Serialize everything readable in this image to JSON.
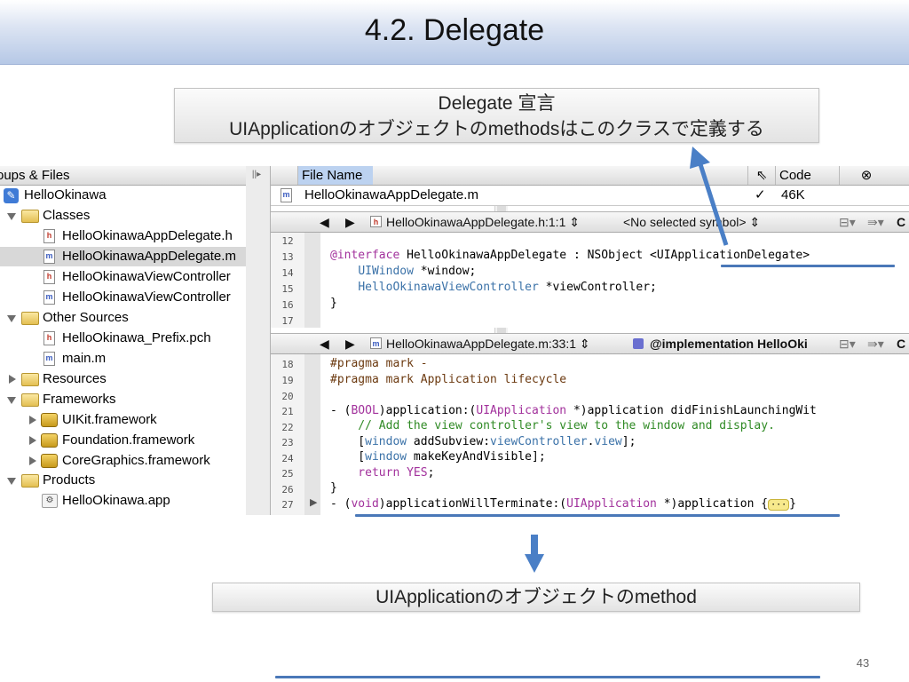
{
  "slide": {
    "title": "4.2. Delegate",
    "callout_top_line1": "Delegate 宣言",
    "callout_top_line2": "UIApplicationのオブジェクトのmethodsはこのクラスで定義する",
    "callout_bottom": "UIApplicationのオブジェクトのmethod",
    "page_number": "43"
  },
  "sidebar": {
    "header": "oups & Files",
    "items": [
      {
        "label": "HelloOkinawa",
        "kind": "project"
      },
      {
        "label": "Classes",
        "kind": "folder-open"
      },
      {
        "label": "HelloOkinawaAppDelegate.h",
        "kind": "h"
      },
      {
        "label": "HelloOkinawaAppDelegate.m",
        "kind": "m"
      },
      {
        "label": "HelloOkinawaViewController",
        "kind": "h"
      },
      {
        "label": "HelloOkinawaViewController",
        "kind": "m"
      },
      {
        "label": "Other Sources",
        "kind": "folder-open"
      },
      {
        "label": "HelloOkinawa_Prefix.pch",
        "kind": "h"
      },
      {
        "label": "main.m",
        "kind": "m"
      },
      {
        "label": "Resources",
        "kind": "folder-closed"
      },
      {
        "label": "Frameworks",
        "kind": "folder-open"
      },
      {
        "label": "UIKit.framework",
        "kind": "framework"
      },
      {
        "label": "Foundation.framework",
        "kind": "framework"
      },
      {
        "label": "CoreGraphics.framework",
        "kind": "framework"
      },
      {
        "label": "Products",
        "kind": "folder-open"
      },
      {
        "label": "HelloOkinawa.app",
        "kind": "app"
      }
    ]
  },
  "file_list": {
    "col_name": "File Name",
    "col_code": "Code",
    "row_name": "HelloOkinawaAppDelegate.m",
    "row_code": "46K"
  },
  "header_pane": {
    "file": "HelloOkinawaAppDelegate.h:1:1",
    "symbol": "<No selected symbol>",
    "lines": [
      "12",
      "13",
      "14",
      "15",
      "16",
      "17"
    ],
    "code": {
      "l13_kw": "@interface",
      "l13_rest": " HelloOkinawaAppDelegate : NSObject <UIApplicationDelegate>",
      "l14_cls": "UIWindow",
      "l14_rest": " *window;",
      "l15_cls": "HelloOkinawaViewController",
      "l15_rest": " *viewController;",
      "l16": "}"
    }
  },
  "impl_pane": {
    "file": "HelloOkinawaAppDelegate.m:33:1",
    "symbol": "@implementation HelloOki",
    "lines": [
      "18",
      "19",
      "20",
      "21",
      "22",
      "23",
      "24",
      "25",
      "26",
      "27"
    ],
    "code": {
      "l18": "#pragma mark -",
      "l19": "#pragma mark Application lifecycle",
      "l21_a": "- (",
      "l21_bool": "BOOL",
      "l21_b": ")application:(",
      "l21_cls": "UIApplication",
      "l21_c": " *)application didFinishLaunchingWit",
      "l22": "    // Add the view controller's view to the window and display.",
      "l23_a": "    [",
      "l23_win": "window",
      "l23_b": " addSubview:",
      "l23_vc": "viewController",
      "l23_c": ".",
      "l23_view": "view",
      "l23_d": "];",
      "l24_a": "    [",
      "l24_win": "window",
      "l24_b": " makeKeyAndVisible];",
      "l25_kw": "    return",
      "l25_yes": " YES",
      "l25_end": ";",
      "l26": "}",
      "l27_a": "- (",
      "l27_void": "void",
      "l27_b": ")applicationWillTerminate:(",
      "l27_cls": "UIApplication",
      "l27_c": " *)application {",
      "l27_ellipsis": "···",
      "l27_end": "}"
    }
  },
  "colors": {
    "accent_arrow": "#4a7fc6",
    "title_gradient_bottom": "#b6c8e6",
    "keyword": "#a2319c",
    "class_name": "#3b72a8",
    "comment": "#2f8a24"
  }
}
